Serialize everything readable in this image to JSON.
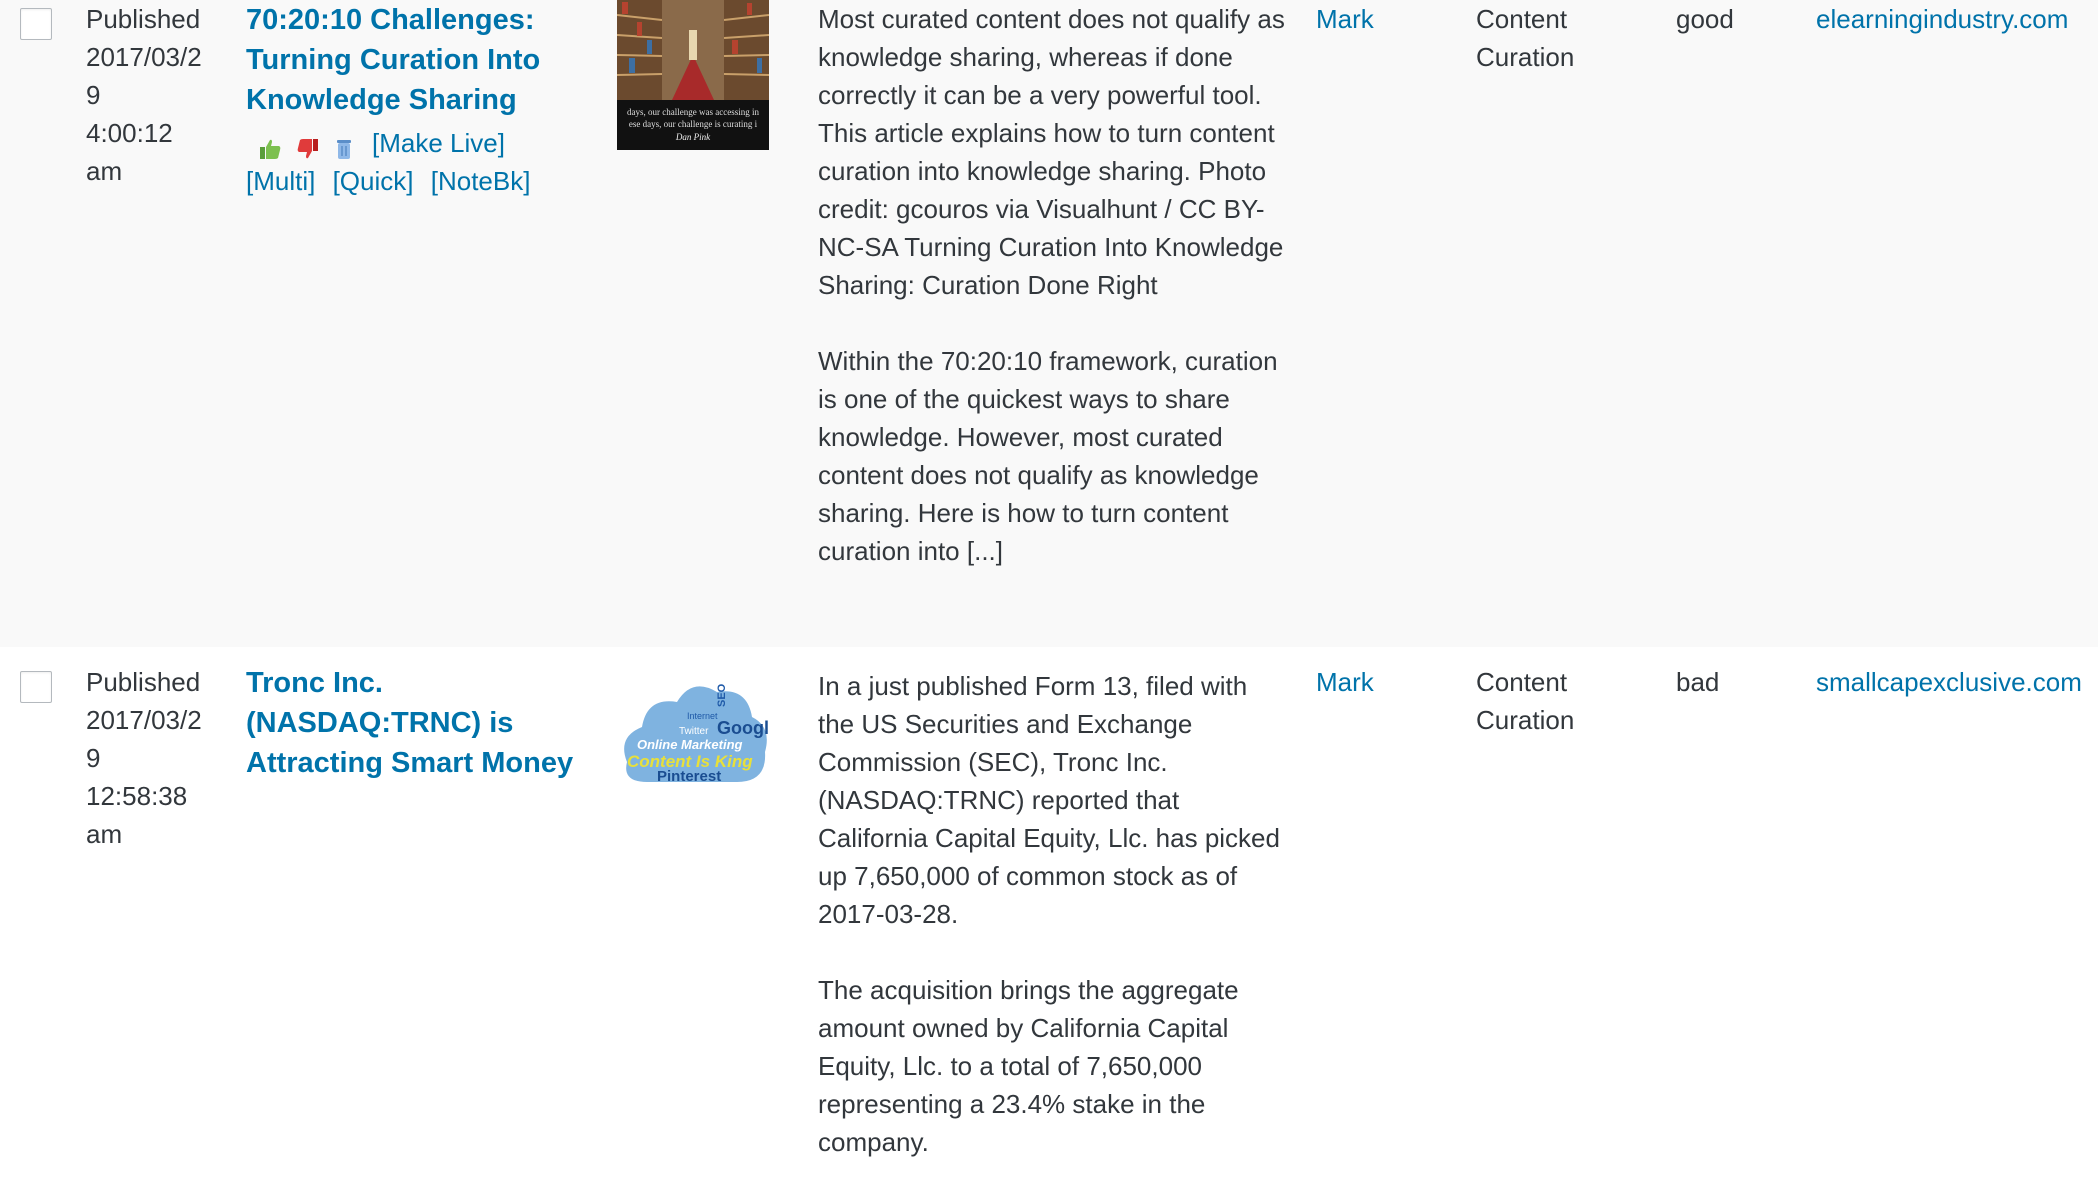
{
  "rows": [
    {
      "status": "Published",
      "date": "2017/03/29",
      "time": "4:00:12 am",
      "title": "70:20:10 Challenges: Turning Curation Into Knowledge Sharing",
      "actions": [
        "[Make Live]",
        "[Multi]",
        "[Quick]",
        "[NoteBk]"
      ],
      "thumbnail_text": [
        "days, our challenge was accessing in",
        "ese days, our challenge is curating i",
        "Dan Pink"
      ],
      "excerpt_p1": "Most curated content does not qualify as knowledge sharing, whereas if done correctly it can be a very powerful tool. This article explains how to turn content curation into knowledge sharing. Photo credit: gcouros via Visualhunt / CC BY-NC-SA Turning Curation Into Knowledge Sharing: Curation Done Right",
      "excerpt_p2": "Within the 70:20:10 framework, curation is one of the quickest ways to share knowledge. However, most curated content does not qualify as knowledge sharing. Here is how to turn content curation into [...]",
      "author": "Mark",
      "category": "Content Curation",
      "rating": "good",
      "domain": "elearningindustry.com"
    },
    {
      "status": "Published",
      "date": "2017/03/29",
      "time": "12:58:38 am",
      "title": "Tronc Inc. (NASDAQ:TRNC) is Attracting Smart Money",
      "thumbnail_text": [
        "Google",
        "Online Marketing",
        "Content Is King",
        "Pinterest",
        "Twitter",
        "Internet",
        "SEO"
      ],
      "excerpt_p1": "In a just published Form 13, filed with the US Securities and Exchange Commission (SEC), Tronc Inc. (NASDAQ:TRNC) reported that California Capital Equity, Llc. has picked up 7,650,000 of common stock as of 2017-03-28.",
      "excerpt_p2": "The acquisition brings the aggregate amount owned by California Capital Equity, Llc. to a total of 7,650,000 representing a 23.4% stake in the company.",
      "author": "Mark",
      "category": "Content Curation",
      "rating": "bad",
      "domain": "smallcapexclusive.com"
    }
  ],
  "icons": [
    "thumbs-up-icon",
    "thumbs-down-icon",
    "trash-icon"
  ],
  "colors": {
    "link": "#0073aa",
    "text": "#32373c",
    "alt_row": "#f9f9f9"
  }
}
